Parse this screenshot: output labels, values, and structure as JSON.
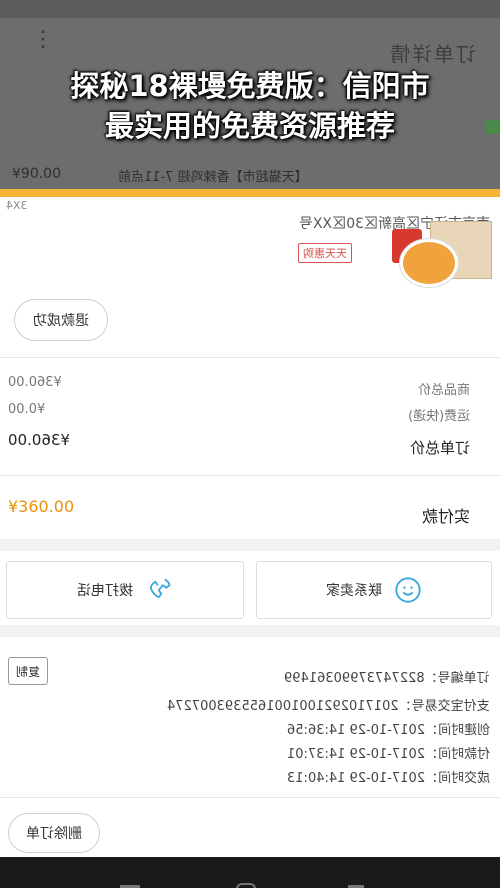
{
  "overlay": {
    "headline_line1": "探秘18裸墁免费版：信阳市",
    "headline_line2": "最实用的免费资源推荐",
    "ghost_title": "订单详情",
    "ghost_price": "¥90.00",
    "ghost_line": "【天猫超市】香辣鸡翅 7-11点前"
  },
  "order": {
    "address": "南京市江宁区高新区30区XX号",
    "address_side": "3X4",
    "tag": "天天惠购",
    "refund_btn": "退款成功"
  },
  "amounts": {
    "goods_label": "商品总价",
    "goods_value": "¥360.00",
    "shipping_label": "运费(快递)",
    "shipping_value": "¥0.00",
    "total_label": "订单总价",
    "total_value": "¥360.00",
    "paid_label": "实付款",
    "paid_value": "¥360.00"
  },
  "contact": {
    "call_label": "拨打电话",
    "chat_label": "联系卖家"
  },
  "details": {
    "copy_btn": "复制",
    "order_no": "订单编号：82274737990361499",
    "alipay_no": "支付宝交易号：2017102921001001655393007274",
    "created": "创建时间：2017-10-29 14:36:56",
    "paid": "付款时间：2017-10-29 14:37:01",
    "done": "成交时间：2017-10-29 14:40:13"
  },
  "footer": {
    "delete_btn": "删除订单"
  },
  "colors": {
    "accent_yellow": "#f5b638",
    "price_orange": "#e8920a",
    "overlay_gray": "#6d6d6d",
    "icon_blue": "#3ba7e0"
  },
  "icons": {
    "phone": "phone-icon",
    "chat": "chat-smile-icon",
    "menu": "more-vert-icon"
  }
}
